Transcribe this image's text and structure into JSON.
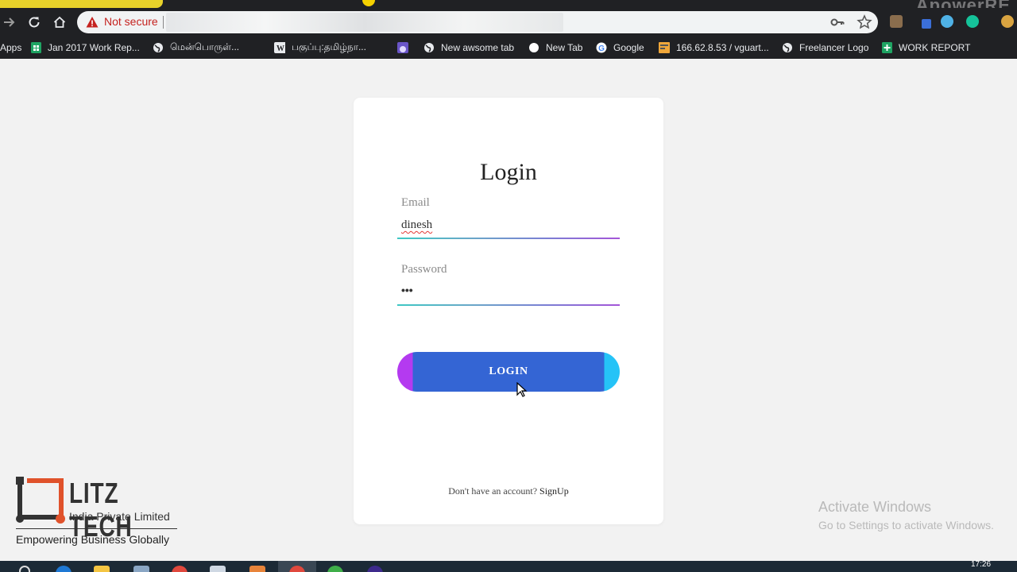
{
  "browser": {
    "security_text": "Not secure",
    "recorder_watermark": "ApowerRE",
    "bookmarks": [
      {
        "label": "Apps",
        "icon": "apps-grid-icon"
      },
      {
        "label": "Jan 2017 Work Rep...",
        "icon": "sheets-icon"
      },
      {
        "label": "மென்பொருள்...",
        "icon": "globe-icon"
      },
      {
        "label": "பகுப்பு:தமிழ்நா...",
        "icon": "wikipedia-icon"
      },
      {
        "label": "",
        "icon": "purple-bookmark-icon"
      },
      {
        "label": "New awsome tab",
        "icon": "globe-icon"
      },
      {
        "label": "New Tab",
        "icon": "circle-icon"
      },
      {
        "label": "Google",
        "icon": "google-icon"
      },
      {
        "label": "166.62.8.53 / vguart...",
        "icon": "phpmyadmin-icon"
      },
      {
        "label": "Freelancer Logo",
        "icon": "globe-icon"
      },
      {
        "label": "WORK REPORT",
        "icon": "sheets-plus-icon"
      }
    ]
  },
  "login": {
    "title": "Login",
    "email_label": "Email",
    "email_value": "dinesh",
    "password_label": "Password",
    "password_value": "•••",
    "button_label": "LOGIN",
    "signup_prompt": "Don't have an account?",
    "signup_link": "SignUp"
  },
  "logo": {
    "brand": "LITZ TECH",
    "subtitle": "India Private Limited",
    "tagline": "Empowering Business Globally"
  },
  "watermark": {
    "line1": "Activate Windows",
    "line2": "Go to Settings to activate Windows."
  },
  "taskbar": {
    "clock": "17:26"
  },
  "colors": {
    "button_main": "#3465d4",
    "button_left_cap": "#b43af0",
    "button_right_cap": "#25c3f7",
    "not_secure": "#c5221f"
  }
}
